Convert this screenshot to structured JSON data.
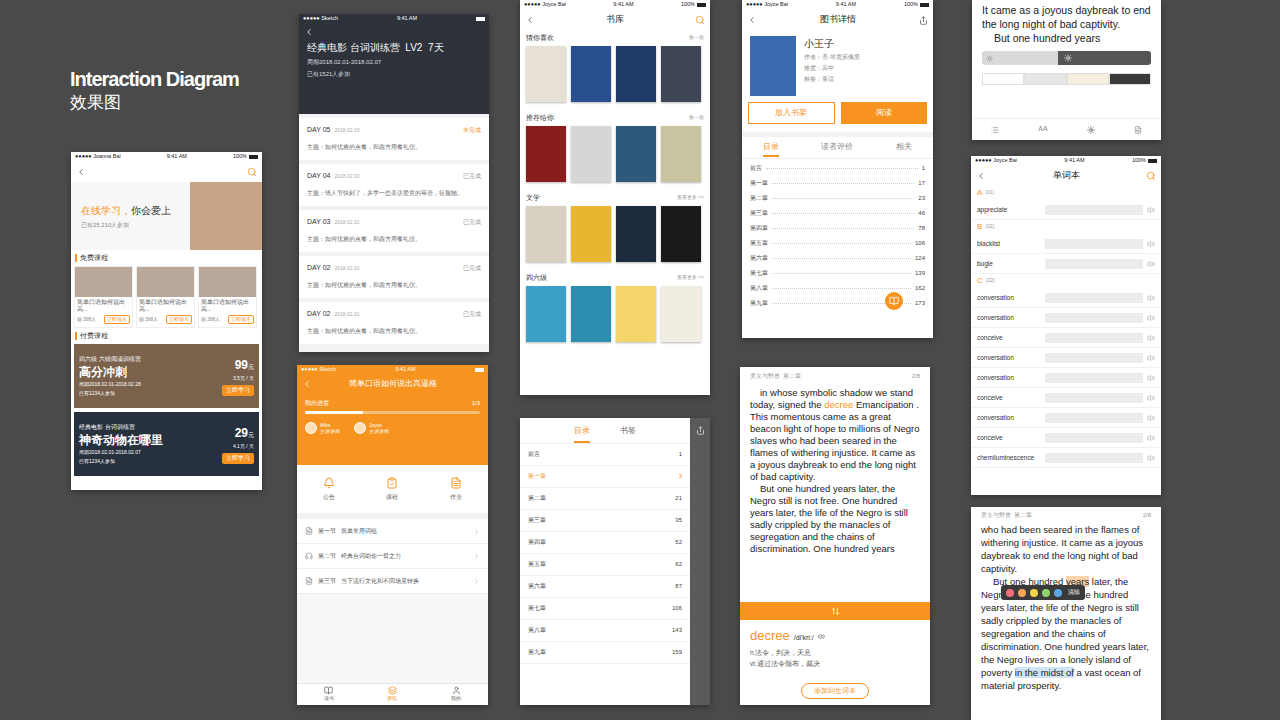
{
  "header": {
    "title": "Interaction Diagram",
    "subtitle": "效果图"
  },
  "home": {
    "status": {
      "carrier": "●●●●● Joanna Bai",
      "time": "9:41 AM",
      "battery": "100%"
    },
    "hero": {
      "highlight": "在线学习，",
      "title": "你会爱上",
      "count": "已有25,210人参加"
    },
    "free_section": "免费课程",
    "free_courses": [
      {
        "title": "简单口语如何说出高...",
        "count": "398人",
        "button": "立即报名"
      },
      {
        "title": "简单口语如何说出高...",
        "count": "398人",
        "button": "立即报名"
      },
      {
        "title": "简单口语如何说出高...",
        "count": "398人",
        "button": "立即报名"
      }
    ],
    "paid_section": "付费课程",
    "paid_courses": [
      {
        "tag": "四六级 六级阅读训练营",
        "title": "高分冲刺",
        "period": "周期2018.02.01-2018.02.28",
        "count": "已有1234人参加",
        "price": "99",
        "unit": "元",
        "daily": "3.5元 / 天",
        "button": "立即学习"
      },
      {
        "tag": "经典电影 台词训练营",
        "title": "神奇动物在哪里",
        "period": "周期2018.02.01-2018.02.07",
        "count": "已有1234人参加",
        "price": "29",
        "unit": "元",
        "daily": "4.1元 / 天",
        "button": "立即学习"
      }
    ]
  },
  "course": {
    "status": {
      "carrier": "●●●●● Sketch",
      "time": "9:41 AM"
    },
    "title": "经典电影 台词训练营  LV2  7天",
    "period": "周期2018.02.01-2018.02.07",
    "count": "已有1521人参加",
    "days": [
      {
        "day": "DAY 05",
        "date": "2018.02.03",
        "status": "未完成",
        "done": false,
        "theme": "主题：如何优雅的点餐，和西方用餐礼仪。"
      },
      {
        "day": "DAY 04",
        "date": "2018.02.02",
        "status": "已完成",
        "done": true,
        "theme": "主题：情人节快到了，多学一些表达爱意的英语，征服她。"
      },
      {
        "day": "DAY 03",
        "date": "2018.02.01",
        "status": "已完成",
        "done": true,
        "theme": "主题：如何优雅的点餐，和西方用餐礼仪。"
      },
      {
        "day": "DAY 02",
        "date": "2018.02.01",
        "status": "已完成",
        "done": true,
        "theme": "主题：如何优雅的点餐，和西方用餐礼仪。"
      },
      {
        "day": "DAY 02",
        "date": "2018.02.01",
        "status": "已完成",
        "done": true,
        "theme": "主题：如何优雅的点餐，和西方用餐礼仪。"
      }
    ]
  },
  "lesson": {
    "status": {
      "carrier": "●●●●● Sketch",
      "time": "9:41 AM"
    },
    "title": "简单口语如何说出高逼格",
    "progress_label": "我的进度",
    "progress": "1/3",
    "level": 0.33,
    "teachers": [
      {
        "name": "Mike",
        "role": "主讲讲师"
      },
      {
        "name": "Joyce",
        "role": "主讲讲师"
      }
    ],
    "actions": [
      {
        "label": "公告",
        "kind": "bell"
      },
      {
        "label": "课程",
        "kind": "clipboard"
      },
      {
        "label": "作业",
        "kind": "file"
      }
    ],
    "lessons": [
      {
        "number": "第一节",
        "title": "简单常用词组",
        "kind": "text"
      },
      {
        "number": "第二节",
        "title": "经典台词助你一臂之力",
        "kind": "audio"
      },
      {
        "number": "第三节",
        "title": "当下流行文化和不同场景转换",
        "kind": "text"
      }
    ],
    "tabbar": [
      {
        "label": "读书",
        "kind": "book",
        "selected": false
      },
      {
        "label": "课程",
        "kind": "layers",
        "selected": true
      },
      {
        "label": "我的",
        "kind": "user",
        "selected": false
      }
    ]
  },
  "library": {
    "status": {
      "carrier": "●●●●● Joyce Bai",
      "time": "9:41 AM",
      "battery": "100%"
    },
    "title": "书库",
    "sections": [
      {
        "title": "猜你喜欢",
        "link": "换一批",
        "books": [
          {
            "color": "#e6e0d6"
          },
          {
            "color": "#2a4f8f"
          },
          {
            "color": "#1f3a66"
          },
          {
            "color": "#3d4557"
          }
        ]
      },
      {
        "title": "推荐给你",
        "link": "换一批",
        "books": [
          {
            "color": "#8b1c1c"
          },
          {
            "color": "#d6d6d6"
          },
          {
            "color": "#2d5a7a"
          },
          {
            "color": "#c9c4a0"
          }
        ]
      },
      {
        "title": "文学",
        "link": "查看更多 >>",
        "books": [
          {
            "color": "#d8d0c0"
          },
          {
            "color": "#e8b730"
          },
          {
            "color": "#1c2b3e"
          },
          {
            "color": "#1a1a1a"
          }
        ]
      },
      {
        "title": "四六级",
        "link": "查看更多 >>",
        "books": [
          {
            "color": "#3aa0c8"
          },
          {
            "color": "#2c8fb0"
          },
          {
            "color": "#f5d56a"
          },
          {
            "color": "#f2ede3"
          }
        ]
      }
    ]
  },
  "toc": {
    "tabs": [
      {
        "label": "目录",
        "selected": true
      },
      {
        "label": "书签",
        "selected": false
      }
    ],
    "chapters": [
      {
        "name": "前言",
        "page": "1",
        "selected": false
      },
      {
        "name": "第一章",
        "page": "3",
        "selected": true
      },
      {
        "name": "第二章",
        "page": "21",
        "selected": false
      },
      {
        "name": "第三章",
        "page": "35",
        "selected": false
      },
      {
        "name": "第四章",
        "page": "52",
        "selected": false
      },
      {
        "name": "第五章",
        "page": "62",
        "selected": false
      },
      {
        "name": "第六章",
        "page": "87",
        "selected": false
      },
      {
        "name": "第七章",
        "page": "106",
        "selected": false
      },
      {
        "name": "第八章",
        "page": "143",
        "selected": false
      },
      {
        "name": "第九章",
        "page": "159",
        "selected": false
      }
    ]
  },
  "detail": {
    "status": {
      "carrier": "●●●●● Joyce Bai",
      "time": "9:41 AM",
      "battery": "100%"
    },
    "title": "图书详情",
    "book": {
      "name": "小王子",
      "author": "作者：圣-埃克苏佩里",
      "level": "难度：高中",
      "tag": "标签：童话"
    },
    "buttons": [
      {
        "label": "放入书架",
        "kind": "outline"
      },
      {
        "label": "阅读",
        "kind": "filled"
      }
    ],
    "tabs": [
      {
        "label": "目录",
        "selected": true
      },
      {
        "label": "读者评价",
        "selected": false
      },
      {
        "label": "相关",
        "selected": false
      }
    ],
    "chapters": [
      {
        "name": "前言",
        "page": "1"
      },
      {
        "name": "第一章",
        "page": "17"
      },
      {
        "name": "第二章",
        "page": "23"
      },
      {
        "name": "第三章",
        "page": "46"
      },
      {
        "name": "第四章",
        "page": "78"
      },
      {
        "name": "第五章",
        "page": "106"
      },
      {
        "name": "第六章",
        "page": "124"
      },
      {
        "name": "第七章",
        "page": "139"
      },
      {
        "name": "第八章",
        "page": "162"
      },
      {
        "name": "第九章",
        "page": "173"
      }
    ]
  },
  "reader": {
    "book": "美女与野兽  第二章",
    "page": "2/8",
    "paragraphs": [
      {
        "segments": [
          {
            "text": "in whose symbolic shadow we stand today, signed the ",
            "selected": false
          },
          {
            "text": "decree",
            "selected": true
          },
          {
            "text": " Emancipation . This momentous came as a great beacon light of hope to millions of Negro slaves who had been seared in the flames of withering injustice. It came as a joyous daybreak to end the long night of bad captivity.",
            "selected": false
          }
        ]
      },
      {
        "segments": [
          {
            "text": "But one hundred years later, the Negro still is not free. One hundred years later, the life of the Negro is still sadly crippled by the manacles of segregation and the chains of discrimination. One hundred years",
            "selected": false
          }
        ]
      }
    ],
    "popup": {
      "word": "decree",
      "phonetic": "/di'kri:/",
      "meanings": [
        "n.法令，判决，天意",
        "vt.通过法令颁布，裁决"
      ],
      "button": "添加到生词本"
    }
  },
  "settings": {
    "paragraphs": [
      "It came as a joyous daybreak to end the long night of bad captivity.",
      "But one hundred years"
    ],
    "brightness": 0.45,
    "backgrounds": [
      {
        "color": "#ffffff"
      },
      {
        "color": "#e6e6e6"
      },
      {
        "color": "#f6efdf"
      },
      {
        "color": "#3a3a3a"
      }
    ],
    "font_button": "AA"
  },
  "words": {
    "status": {
      "carrier": "●●●●● Joyce Bai",
      "time": "9:41 AM",
      "battery": "100%"
    },
    "title": "单词本",
    "groups": [
      {
        "letter": "A",
        "count": "(01)",
        "words": [
          "appreciate"
        ]
      },
      {
        "letter": "B",
        "count": "(02)",
        "words": [
          "blacklist",
          "bugle"
        ]
      },
      {
        "letter": "C",
        "count": "(22)",
        "words": [
          "conversation",
          "conversation",
          "conceive",
          "conversation",
          "conversation",
          "conceive",
          "conversation",
          "conceive",
          "chemiluminescence"
        ]
      }
    ]
  },
  "highlight": {
    "book": "美女与野兽  第二章",
    "page": "2/8",
    "paragraphs": [
      {
        "segments": [
          {
            "text": "who had been seared in the flames of withering injustice. It came as a joyous daybreak to end the long night of bad captivity."
          }
        ]
      },
      {
        "segments": [
          {
            "text": "But one hundred "
          },
          {
            "text": "years",
            "color": "#fcd3a8"
          },
          {
            "text": " later, the Negro still is not free. One hundred years later, the life of the Negro is still sadly crippled by the manacles of segregation and the chains of discrimination. One hundred years later, the Negro lives on a lonely island of poverty "
          },
          {
            "text": "in the midst of",
            "color": "#cfe3f7"
          },
          {
            "text": " a vast ocean of material prosperity."
          }
        ]
      }
    ],
    "palette": [
      {
        "color": "#f26d7d"
      },
      {
        "color": "#f7a35c"
      },
      {
        "color": "#f5d547"
      },
      {
        "color": "#8fd16a"
      },
      {
        "color": "#5aa9e6"
      }
    ],
    "clear": "清除"
  }
}
